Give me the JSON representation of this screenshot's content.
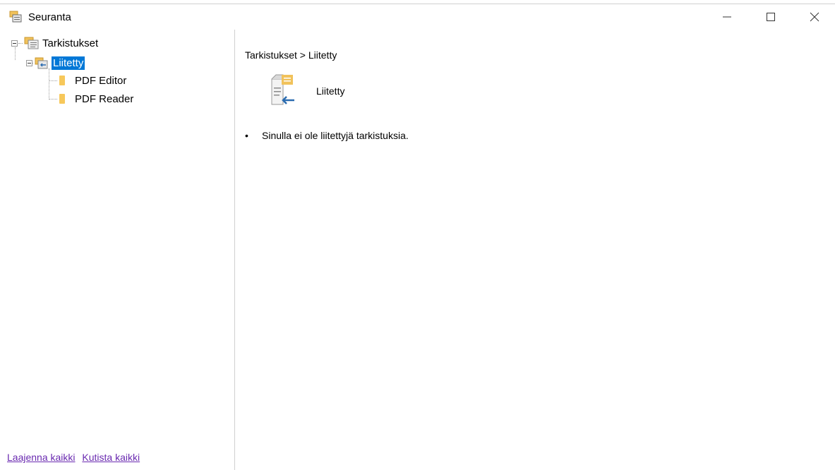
{
  "window": {
    "title": "Seuranta",
    "controls": {
      "minimize_icon": "minimize-icon",
      "maximize_icon": "maximize-icon",
      "close_icon": "close-icon"
    }
  },
  "tree": {
    "root": {
      "label": "Tarkistukset",
      "icon": "review-list-icon",
      "expanded": true
    },
    "child": {
      "label": "Liitetty",
      "icon": "attached-document-icon",
      "expanded": true,
      "selected": true
    },
    "leaves": [
      {
        "label": "PDF Editor",
        "icon": "folder-icon"
      },
      {
        "label": "PDF Reader",
        "icon": "folder-icon"
      }
    ]
  },
  "footer_links": {
    "expand_all": "Laajenna kaikki",
    "collapse_all": "Kutista kaikki"
  },
  "content": {
    "breadcrumb": "Tarkistukset > Liitetty",
    "section_title": "Liitetty",
    "section_icon": "attached-document-icon",
    "bullet": "•",
    "message": "Sinulla ei ole liitettyjä tarkistuksia."
  },
  "colors": {
    "selection": "#0078d7",
    "link": "#6a2ab0",
    "folder": "#f7c85b",
    "divider": "#cfcfcf"
  }
}
